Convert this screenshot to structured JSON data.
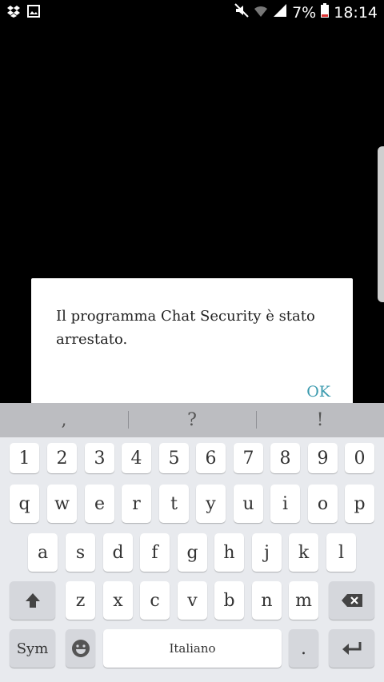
{
  "status_bar": {
    "battery_percent": "7%",
    "time": "18:14",
    "icons": [
      "dropbox-icon",
      "image-icon",
      "mute-icon",
      "wifi-icon",
      "signal-icon",
      "battery-icon"
    ]
  },
  "dialog": {
    "message": "Il programma Chat Security è stato arrestato.",
    "ok_label": "OK"
  },
  "keyboard": {
    "suggestions": [
      ",",
      "?",
      "!"
    ],
    "row_numbers": [
      "1",
      "2",
      "3",
      "4",
      "5",
      "6",
      "7",
      "8",
      "9",
      "0"
    ],
    "row_top": [
      "q",
      "w",
      "e",
      "r",
      "t",
      "y",
      "u",
      "i",
      "o",
      "p"
    ],
    "row_middle": [
      "a",
      "s",
      "d",
      "f",
      "g",
      "h",
      "j",
      "k",
      "l"
    ],
    "row_bottom": [
      "z",
      "x",
      "c",
      "v",
      "b",
      "n",
      "m"
    ],
    "sym_label": "Sym",
    "space_label": "Italiano",
    "period_label": "."
  },
  "colors": {
    "accent": "#3a9aae",
    "keyboard_bg": "#e8eaee",
    "suggestion_bg": "#bcbdc1"
  }
}
